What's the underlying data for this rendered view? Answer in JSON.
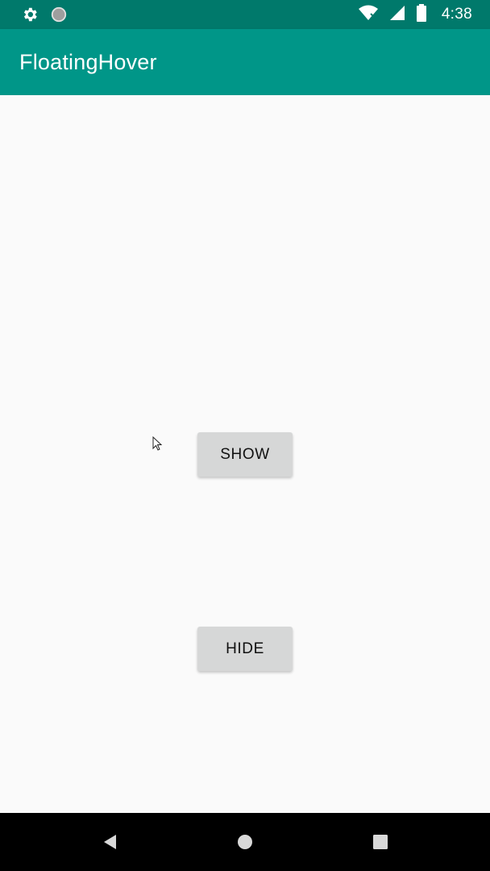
{
  "status_bar": {
    "time": "4:38",
    "icons": [
      "settings-icon",
      "circle-notification-icon",
      "wifi-icon",
      "signal-icon",
      "battery-icon"
    ]
  },
  "app_bar": {
    "title": "FloatingHover"
  },
  "main": {
    "show_button_label": "SHOW",
    "hide_button_label": "HIDE"
  },
  "nav_bar": {
    "icons": [
      "back-icon",
      "home-icon",
      "recents-icon"
    ]
  },
  "colors": {
    "status_bar": "#00796b",
    "app_bar": "#009688",
    "background": "#fafafa",
    "button": "#d6d7d7",
    "nav_bar": "#000000"
  }
}
